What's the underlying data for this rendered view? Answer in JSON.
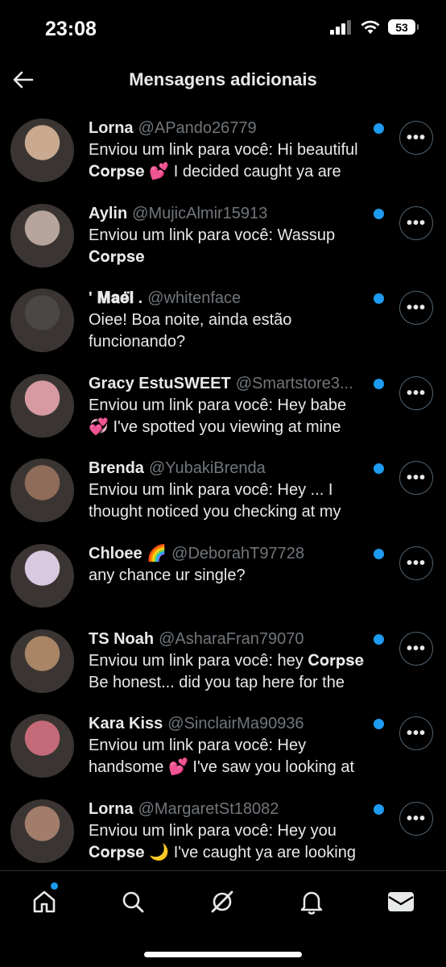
{
  "status": {
    "time": "23:08",
    "battery": "53"
  },
  "header": {
    "title": "Mensagens adicionais"
  },
  "conversations": [
    {
      "name": "Lorna",
      "handle": "@APando26779",
      "preview": "Enviou um link para você: Hi beautiful 𝐂𝐨𝐫𝐩𝐬𝐞 💕 I decided caught ya are",
      "avatar_color": "#c9a98f",
      "unread": true
    },
    {
      "name": "Aylin",
      "handle": "@MujicAlmir15913",
      "preview": "Enviou um link para você: Wassup 𝐂𝐨𝐫𝐩𝐬𝐞",
      "avatar_color": "#b7a59b",
      "unread": true
    },
    {
      "name": "' 𝐌𝐚𝐞̈𝐥 .",
      "handle": "@whitenface",
      "preview": "Oiee! Boa noite, ainda estão funcionando?",
      "avatar_color": "#4a4744",
      "unread": true
    },
    {
      "name": "Gracy EstuSWEET",
      "handle": "@Smartstore3...",
      "preview": "Enviou um link para você: Hey babe 💞 I've spotted you viewing at mine",
      "avatar_color": "#d79aa3",
      "unread": true
    },
    {
      "name": "Brenda",
      "handle": "@YubakiBrenda",
      "preview": "Enviou um link para você: Hey ... I thought noticed you checking at my",
      "avatar_color": "#8f6c5a",
      "unread": true
    },
    {
      "name": "Chloee 🌈",
      "handle": "@DeborahT97728",
      "preview": "any chance ur single?",
      "avatar_color": "#d8c9e0",
      "unread": true
    },
    {
      "name": "TS Noah",
      "handle": "@AsharaFran79070",
      "preview": "Enviou um link para você: hey 𝐂𝐨𝐫𝐩𝐬𝐞 Be honest... did you tap here for the",
      "avatar_color": "#a98566",
      "unread": true
    },
    {
      "name": "Kara Kiss",
      "handle": "@SinclairMa90936",
      "preview": "Enviou um link para você: Hey handsome 💕 I've saw you looking at",
      "avatar_color": "#c46a78",
      "unread": true
    },
    {
      "name": "Lorna",
      "handle": "@MargaretSt18082",
      "preview": "Enviou um link para você: Hey you 𝐂𝐨𝐫𝐩𝐬𝐞 🌙 I've caught ya are looking",
      "avatar_color": "#a37d6b",
      "unread": true
    }
  ],
  "more_label": "•••",
  "tabs": [
    "home",
    "search",
    "grok",
    "notifications",
    "messages"
  ]
}
